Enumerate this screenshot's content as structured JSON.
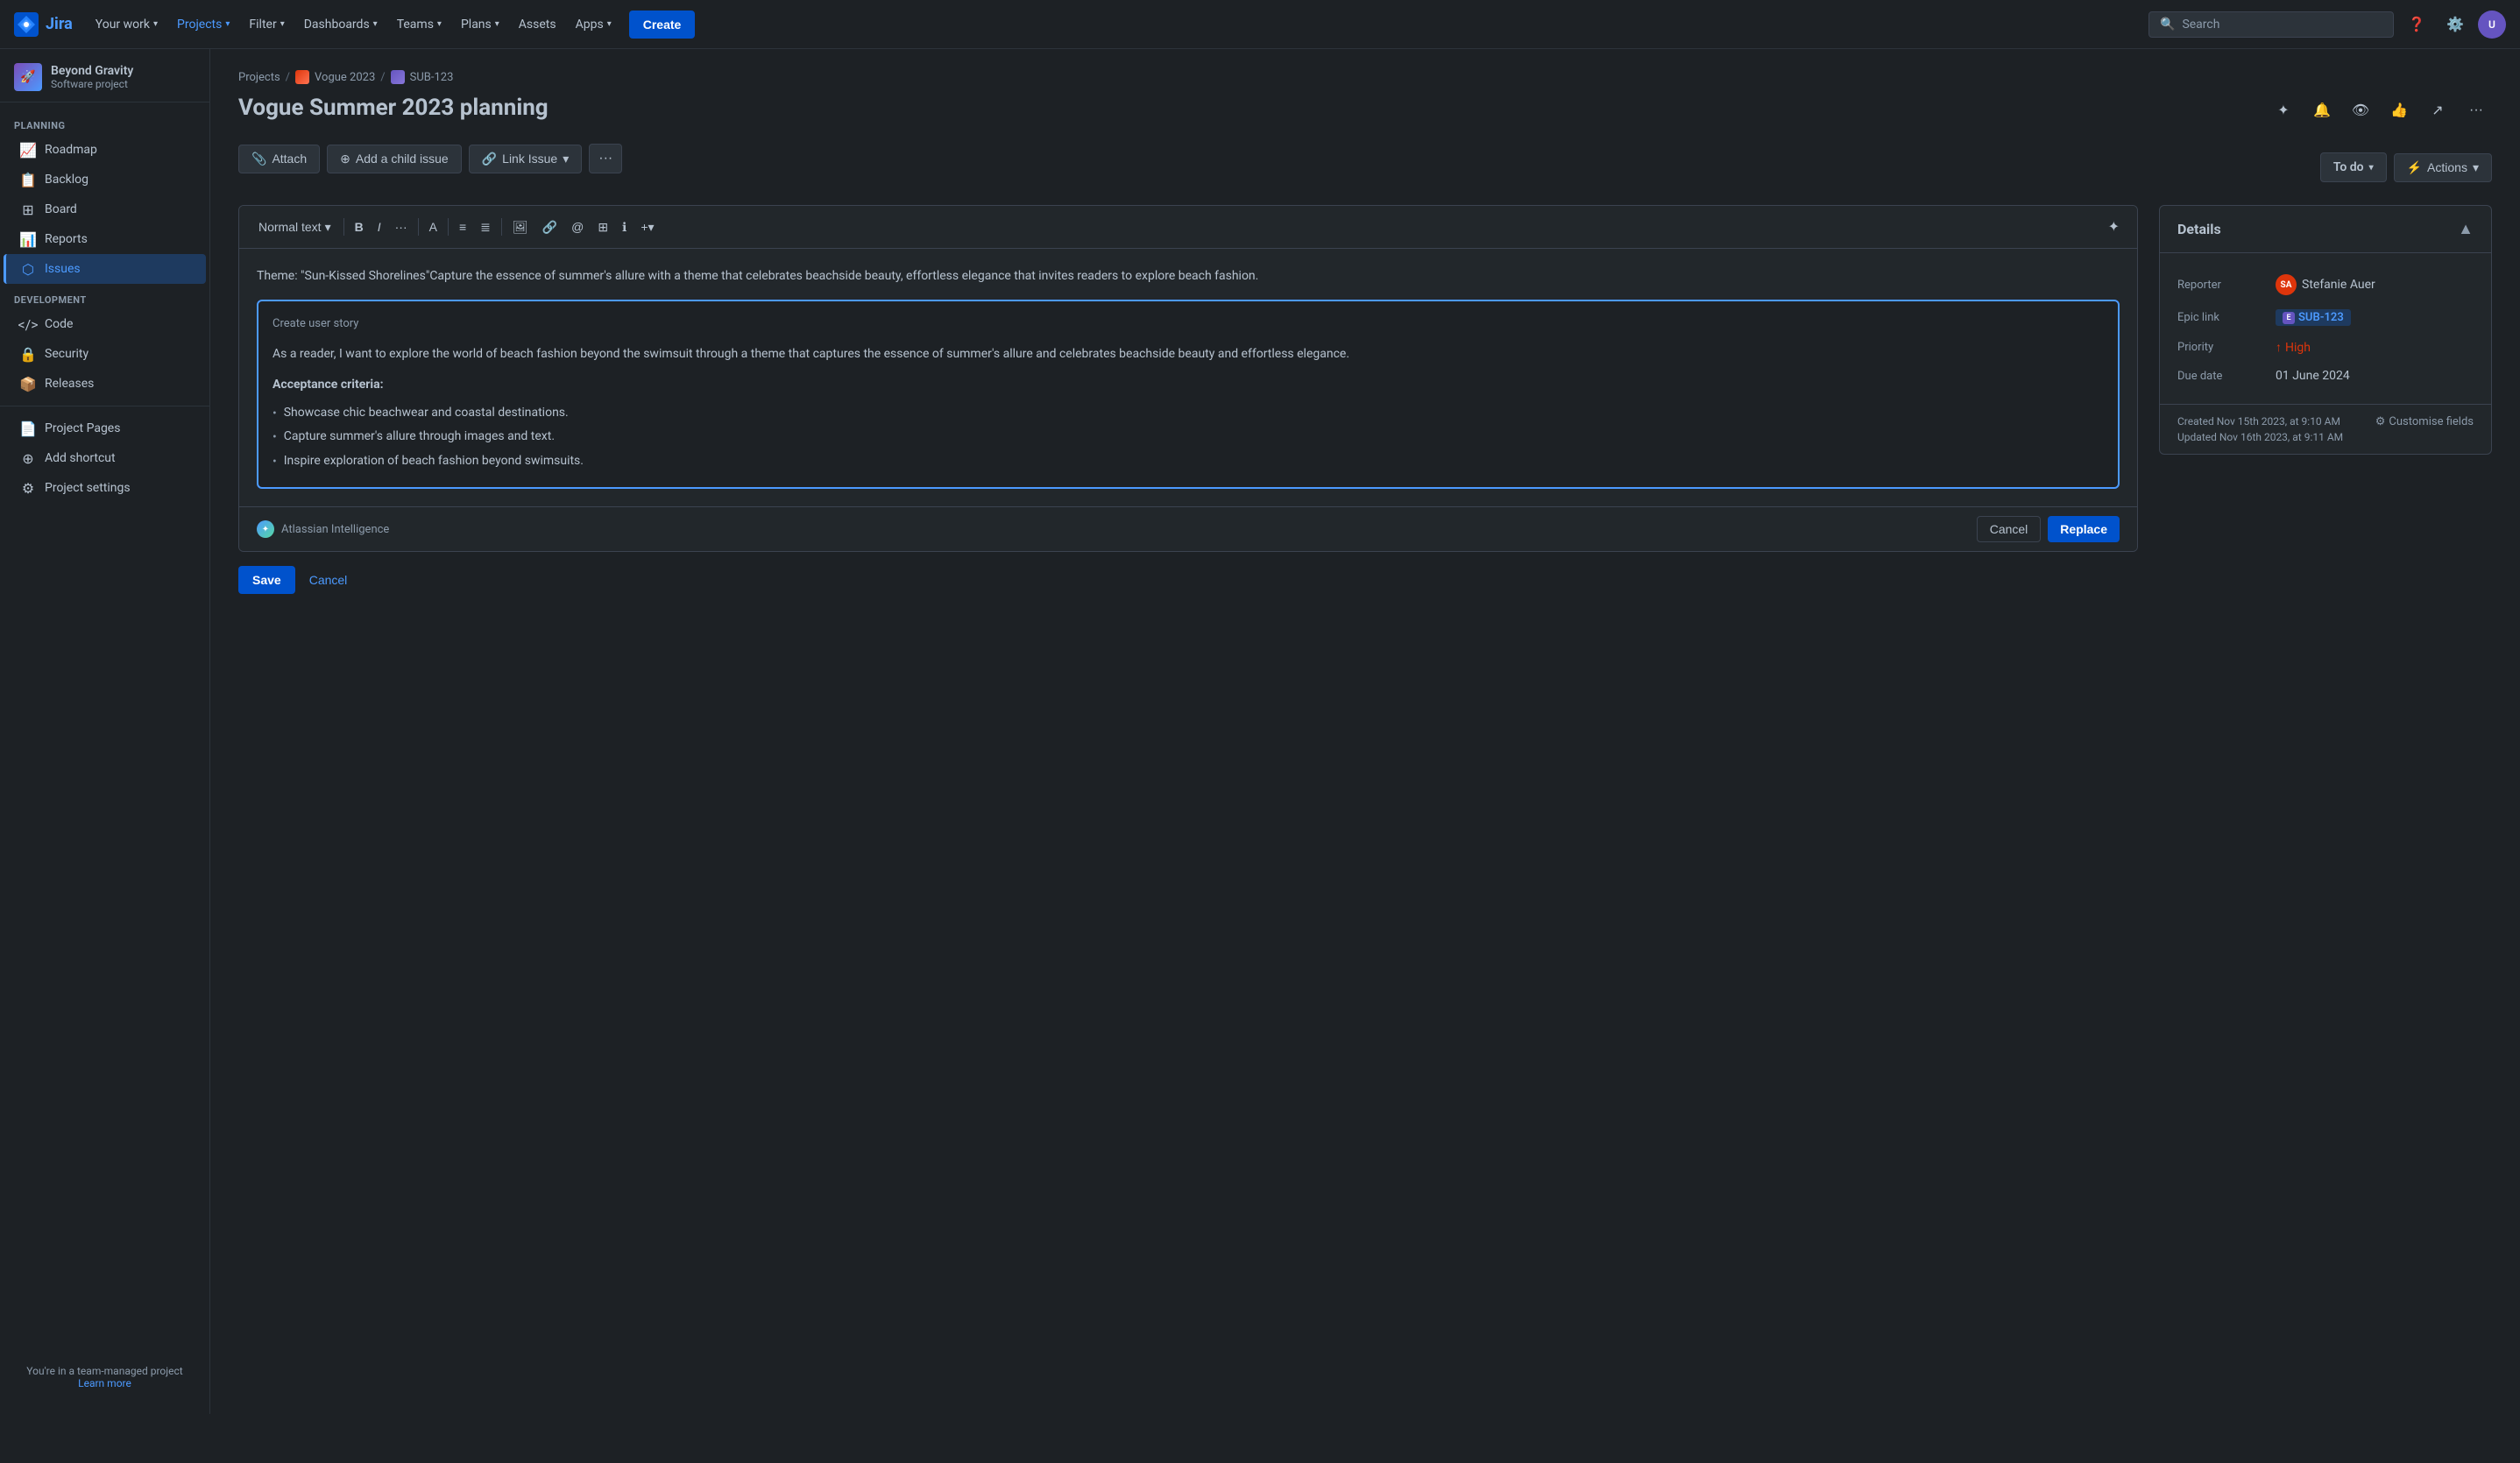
{
  "app": {
    "title": "Jira"
  },
  "topnav": {
    "your_work": "Your work",
    "projects": "Projects",
    "filter": "Filter",
    "dashboards": "Dashboards",
    "teams": "Teams",
    "plans": "Plans",
    "assets": "Assets",
    "apps": "Apps",
    "create": "Create",
    "search_placeholder": "Search"
  },
  "sidebar": {
    "project_name": "Beyond Gravity",
    "project_type": "Software project",
    "planning_label": "PLANNING",
    "development_label": "DEVELOPMENT",
    "items": {
      "roadmap": "Roadmap",
      "backlog": "Backlog",
      "board": "Board",
      "reports": "Reports",
      "issues": "Issues",
      "code": "Code",
      "security": "Security",
      "releases": "Releases",
      "project_pages": "Project Pages",
      "add_shortcut": "Add shortcut",
      "project_settings": "Project settings"
    },
    "footer_text": "You're in a team-managed project",
    "learn_more": "Learn more"
  },
  "breadcrumb": {
    "projects": "Projects",
    "vogue_2023": "Vogue 2023",
    "sub_123": "SUB-123"
  },
  "page": {
    "title": "Vogue Summer 2023 planning",
    "status": "To do",
    "actions": "Actions"
  },
  "toolbar": {
    "attach": "Attach",
    "add_child_issue": "Add a child issue",
    "link_issue": "Link Issue"
  },
  "editor": {
    "text_style": "Normal text",
    "theme_text": "Theme:  \"Sun-Kissed Shorelines\"Capture the essence of summer's allure with a theme that celebrates beachside beauty, effortless elegance that invites readers to explore  beach fashion.",
    "ai_suggestion_title": "Create user story",
    "ai_story": "As a reader, I want to explore the world of beach fashion beyond the swimsuit through a theme that captures the essence of summer's allure and celebrates beachside beauty and effortless elegance.",
    "acceptance_criteria": "Acceptance criteria:",
    "bullets": [
      "Showcase chic beachwear and coastal destinations.",
      "Capture summer's allure through images and text.",
      "Inspire exploration of beach fashion beyond swimsuits."
    ],
    "ai_brand": "Atlassian Intelligence",
    "cancel_label": "Cancel",
    "replace_label": "Replace",
    "save_label": "Save",
    "cancel_edit_label": "Cancel"
  },
  "details": {
    "title": "Details",
    "reporter_label": "Reporter",
    "reporter_name": "Stefanie Auer",
    "reporter_initials": "SA",
    "epic_link_label": "Epic link",
    "epic_link": "SUB-123",
    "priority_label": "Priority",
    "priority": "High",
    "due_date_label": "Due date",
    "due_date": "01 June 2024",
    "created": "Created Nov 15th 2023, at 9:10 AM",
    "updated": "Updated Nov 16th 2023, at 9:11 AM",
    "customise_fields": "Customise fields"
  }
}
